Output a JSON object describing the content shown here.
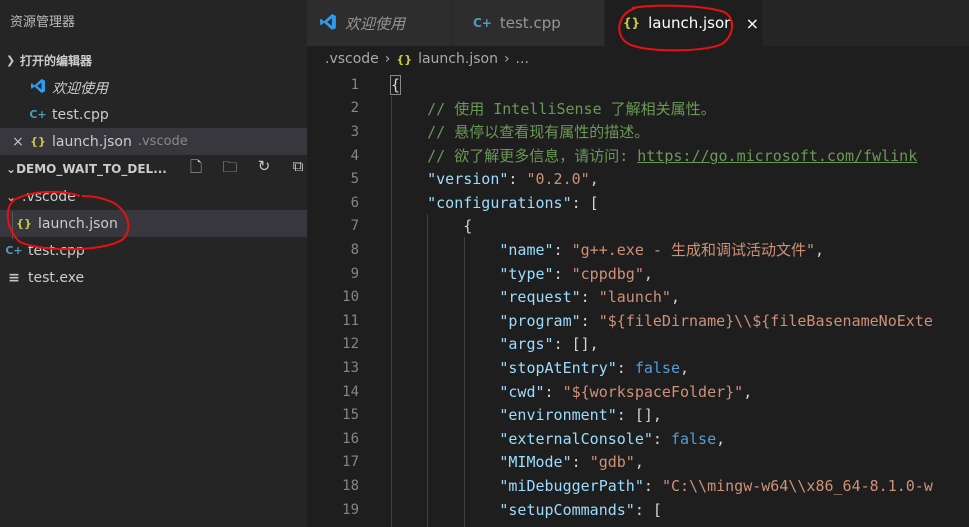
{
  "sidebar": {
    "title": "资源管理器",
    "open_editors": {
      "header": "打开的编辑器",
      "items": [
        {
          "label": "欢迎使用",
          "icon": "vscode-icon"
        },
        {
          "label": "test.cpp",
          "icon": "cpp-file-icon"
        },
        {
          "label": "launch.json",
          "folder": ".vscode",
          "icon": "json-file-icon",
          "close": "×"
        }
      ]
    },
    "folder": {
      "name": "DEMO_WAIT_TO_DEL...",
      "actions": [
        "new-file-icon",
        "new-folder-icon",
        "refresh-icon",
        "collapse-all-icon"
      ],
      "tree": [
        {
          "label": ".vscode",
          "icon": "chevron-down-icon"
        },
        {
          "label": "launch.json",
          "icon": "json-file-icon"
        },
        {
          "label": "test.cpp",
          "icon": "cpp-file-icon"
        },
        {
          "label": "test.exe",
          "icon": "file-lines-icon"
        }
      ]
    }
  },
  "tabs": [
    {
      "label": "欢迎使用",
      "icon": "vscode-icon"
    },
    {
      "label": "test.cpp",
      "icon": "cpp-file-icon"
    },
    {
      "label": "launch.json",
      "icon": "json-file-icon",
      "close": "×"
    }
  ],
  "breadcrumb": [
    ".vscode",
    "launch.json",
    "..."
  ],
  "editor": {
    "lines": [
      {
        "n": "1",
        "tokens": [
          [
            "p",
            "{"
          ]
        ]
      },
      {
        "n": "2",
        "tokens": [
          [
            "c",
            "    // 使用 IntelliSense 了解相关属性。"
          ]
        ]
      },
      {
        "n": "3",
        "tokens": [
          [
            "c",
            "    // 悬停以查看现有属性的描述。"
          ]
        ]
      },
      {
        "n": "4",
        "tokens": [
          [
            "c",
            "    // 欲了解更多信息，请访问: "
          ],
          [
            "u",
            "https://go.microsoft.com/fwlink"
          ]
        ]
      },
      {
        "n": "5",
        "tokens": [
          [
            "p",
            "    "
          ],
          [
            "k",
            "\"version\""
          ],
          [
            "p",
            ": "
          ],
          [
            "s",
            "\"0.2.0\""
          ],
          [
            "p",
            ","
          ]
        ]
      },
      {
        "n": "6",
        "tokens": [
          [
            "p",
            "    "
          ],
          [
            "k",
            "\"configurations\""
          ],
          [
            "p",
            ": ["
          ]
        ]
      },
      {
        "n": "7",
        "tokens": [
          [
            "p",
            "        {"
          ]
        ]
      },
      {
        "n": "8",
        "tokens": [
          [
            "p",
            "            "
          ],
          [
            "k",
            "\"name\""
          ],
          [
            "p",
            ": "
          ],
          [
            "s",
            "\"g++.exe - 生成和调试活动文件\""
          ],
          [
            "p",
            ","
          ]
        ]
      },
      {
        "n": "9",
        "tokens": [
          [
            "p",
            "            "
          ],
          [
            "k",
            "\"type\""
          ],
          [
            "p",
            ": "
          ],
          [
            "s",
            "\"cppdbg\""
          ],
          [
            "p",
            ","
          ]
        ]
      },
      {
        "n": "10",
        "tokens": [
          [
            "p",
            "            "
          ],
          [
            "k",
            "\"request\""
          ],
          [
            "p",
            ": "
          ],
          [
            "s",
            "\"launch\""
          ],
          [
            "p",
            ","
          ]
        ]
      },
      {
        "n": "11",
        "tokens": [
          [
            "p",
            "            "
          ],
          [
            "k",
            "\"program\""
          ],
          [
            "p",
            ": "
          ],
          [
            "s",
            "\"${fileDirname}\\\\${fileBasenameNoExte"
          ]
        ]
      },
      {
        "n": "12",
        "tokens": [
          [
            "p",
            "            "
          ],
          [
            "k",
            "\"args\""
          ],
          [
            "p",
            ": [],"
          ]
        ]
      },
      {
        "n": "13",
        "tokens": [
          [
            "p",
            "            "
          ],
          [
            "k",
            "\"stopAtEntry\""
          ],
          [
            "p",
            ": "
          ],
          [
            "b",
            "false"
          ],
          [
            "p",
            ","
          ]
        ]
      },
      {
        "n": "14",
        "tokens": [
          [
            "p",
            "            "
          ],
          [
            "k",
            "\"cwd\""
          ],
          [
            "p",
            ": "
          ],
          [
            "s",
            "\"${workspaceFolder}\""
          ],
          [
            "p",
            ","
          ]
        ]
      },
      {
        "n": "15",
        "tokens": [
          [
            "p",
            "            "
          ],
          [
            "k",
            "\"environment\""
          ],
          [
            "p",
            ": [],"
          ]
        ]
      },
      {
        "n": "16",
        "tokens": [
          [
            "p",
            "            "
          ],
          [
            "k",
            "\"externalConsole\""
          ],
          [
            "p",
            ": "
          ],
          [
            "b",
            "false"
          ],
          [
            "p",
            ","
          ]
        ]
      },
      {
        "n": "17",
        "tokens": [
          [
            "p",
            "            "
          ],
          [
            "k",
            "\"MIMode\""
          ],
          [
            "p",
            ": "
          ],
          [
            "s",
            "\"gdb\""
          ],
          [
            "p",
            ","
          ]
        ]
      },
      {
        "n": "18",
        "tokens": [
          [
            "p",
            "            "
          ],
          [
            "k",
            "\"miDebuggerPath\""
          ],
          [
            "p",
            ": "
          ],
          [
            "s",
            "\"C:\\\\mingw-w64\\\\x86_64-8.1.0-w"
          ]
        ]
      },
      {
        "n": "19",
        "tokens": [
          [
            "p",
            "            "
          ],
          [
            "k",
            "\"setupCommands\""
          ],
          [
            "p",
            ": ["
          ]
        ]
      }
    ]
  },
  "colors": {
    "sidebar_bg": "#252526",
    "editor_bg": "#1e1e1e",
    "selection_bg": "#37373d",
    "annotation_red": "#e81010"
  }
}
